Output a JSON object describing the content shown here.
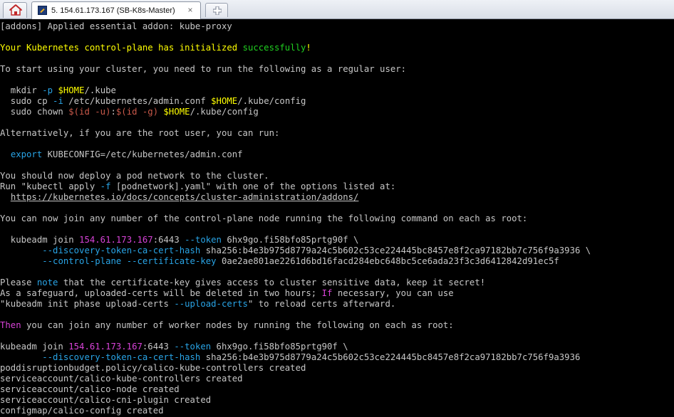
{
  "tabs": {
    "home_icon": "home-icon",
    "active_title": "5. 154.61.173.167 (SB-K8s-Master)",
    "close_glyph": "×",
    "new_tab_icon": "new-tab-icon"
  },
  "colors": {
    "background": "#000000",
    "text": "#c7c7c7",
    "yellow": "#ffff00",
    "green": "#20d020",
    "cyan": "#29a4e6",
    "magenta": "#d843d8",
    "red": "#c9594a"
  },
  "terminal": {
    "lines": [
      [
        {
          "t": "[addons] Applied essential addon: kube-proxy"
        }
      ],
      [],
      [
        {
          "t": "Your Kubernetes control-plane has initialized ",
          "c": "yellow"
        },
        {
          "t": "successfully",
          "c": "green"
        },
        {
          "t": "!",
          "c": "yellow"
        }
      ],
      [],
      [
        {
          "t": "To start using your cluster, you need to run the following as a regular user:"
        }
      ],
      [],
      [
        {
          "t": "  mkdir "
        },
        {
          "t": "-p",
          "c": "cyan"
        },
        {
          "t": " "
        },
        {
          "t": "$HOME",
          "c": "yellow"
        },
        {
          "t": "/.kube"
        }
      ],
      [
        {
          "t": "  sudo cp "
        },
        {
          "t": "-i",
          "c": "cyan"
        },
        {
          "t": " /etc/kubernetes/admin.conf "
        },
        {
          "t": "$HOME",
          "c": "yellow"
        },
        {
          "t": "/.kube/config"
        }
      ],
      [
        {
          "t": "  sudo chown "
        },
        {
          "t": "$(id -u)",
          "c": "red"
        },
        {
          "t": ":"
        },
        {
          "t": "$(id -g)",
          "c": "red"
        },
        {
          "t": " "
        },
        {
          "t": "$HOME",
          "c": "yellow"
        },
        {
          "t": "/.kube/config"
        }
      ],
      [],
      [
        {
          "t": "Alternatively, if you are the root user, you can run:"
        }
      ],
      [],
      [
        {
          "t": "  "
        },
        {
          "t": "export",
          "c": "cyan"
        },
        {
          "t": " KUBECONFIG=/etc/kubernetes/admin.conf"
        }
      ],
      [],
      [
        {
          "t": "You should now deploy a pod network to the cluster."
        }
      ],
      [
        {
          "t": "Run \"kubectl apply "
        },
        {
          "t": "-f",
          "c": "cyan"
        },
        {
          "t": " [podnetwork].yaml\" with one of the options listed at:"
        }
      ],
      [
        {
          "t": "  "
        },
        {
          "t": "https://kubernetes.io/docs/concepts/cluster-administration/addons/",
          "c": "link"
        }
      ],
      [],
      [
        {
          "t": "You can now join any number of the control-plane node running the following command on each as root:"
        }
      ],
      [],
      [
        {
          "t": "  kubeadm join "
        },
        {
          "t": "154.61.173.167",
          "c": "magenta"
        },
        {
          "t": ":6443 "
        },
        {
          "t": "--token",
          "c": "cyan"
        },
        {
          "t": " 6hx9go.fi58bfo85prtg90f \\"
        }
      ],
      [
        {
          "t": "        "
        },
        {
          "t": "--discovery-token-ca-cert-hash",
          "c": "cyan"
        },
        {
          "t": " sha256:b4e3b975d8779a24c5b602c53ce224445bc8457e8f2ca97182bb7c756f9a3936 \\"
        }
      ],
      [
        {
          "t": "        "
        },
        {
          "t": "--control-plane",
          "c": "cyan"
        },
        {
          "t": " "
        },
        {
          "t": "--certificate-key",
          "c": "cyan"
        },
        {
          "t": " 0ae2ae801ae2261d6bd16facd284ebc648bc5ce6ada23f3c3d6412842d91ec5f"
        }
      ],
      [],
      [
        {
          "t": "Please "
        },
        {
          "t": "note",
          "c": "cyan"
        },
        {
          "t": " that the certificate-key gives access to cluster sensitive data, keep it secret!"
        }
      ],
      [
        {
          "t": "As a safeguard, uploaded-certs will be deleted in two hours; "
        },
        {
          "t": "If",
          "c": "magenta"
        },
        {
          "t": " necessary, you can use"
        }
      ],
      [
        {
          "t": "\"kubeadm init phase upload-certs "
        },
        {
          "t": "--upload-certs",
          "c": "cyan"
        },
        {
          "t": "\" to reload certs afterward."
        }
      ],
      [],
      [
        {
          "t": "Then",
          "c": "magenta"
        },
        {
          "t": " you can join any number of worker nodes by running the following on each as root:"
        }
      ],
      [],
      [
        {
          "t": "kubeadm join "
        },
        {
          "t": "154.61.173.167",
          "c": "magenta"
        },
        {
          "t": ":6443 "
        },
        {
          "t": "--token",
          "c": "cyan"
        },
        {
          "t": " 6hx9go.fi58bfo85prtg90f \\"
        }
      ],
      [
        {
          "t": "        "
        },
        {
          "t": "--discovery-token-ca-cert-hash",
          "c": "cyan"
        },
        {
          "t": " sha256:b4e3b975d8779a24c5b602c53ce224445bc8457e8f2ca97182bb7c756f9a3936"
        }
      ],
      [
        {
          "t": "poddisruptionbudget.policy/calico-kube-controllers created"
        }
      ],
      [
        {
          "t": "serviceaccount/calico-kube-controllers created"
        }
      ],
      [
        {
          "t": "serviceaccount/calico-node created"
        }
      ],
      [
        {
          "t": "serviceaccount/calico-cni-plugin created"
        }
      ],
      [
        {
          "t": "configmap/calico-config created"
        }
      ]
    ]
  }
}
